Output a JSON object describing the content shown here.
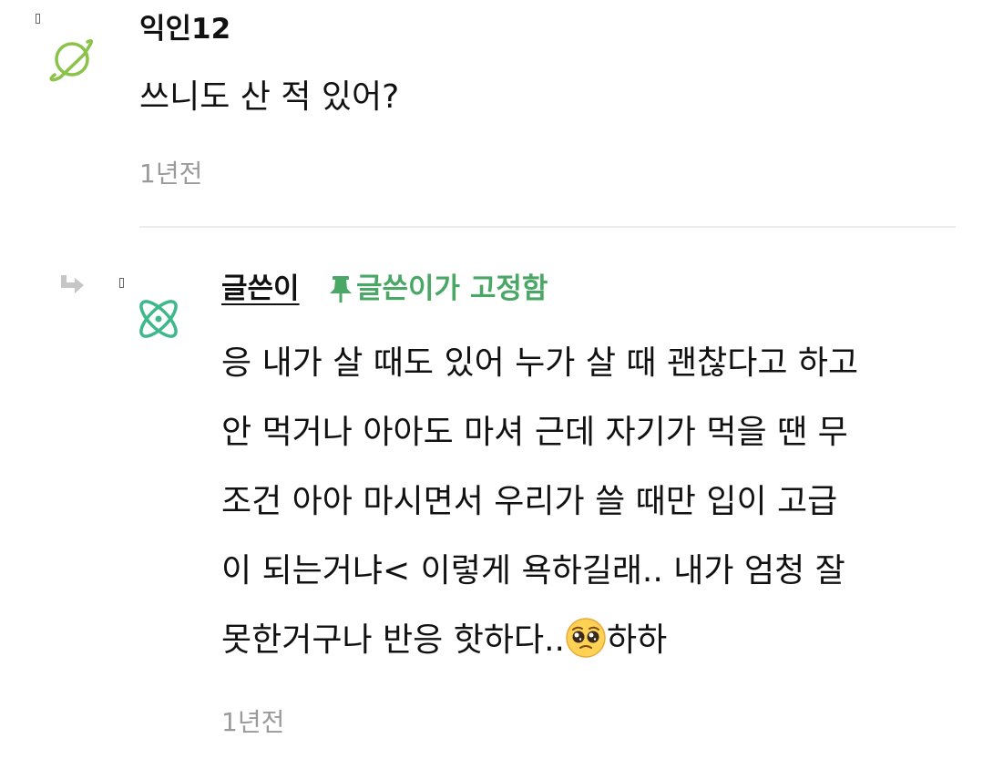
{
  "comment": {
    "username": "익인12",
    "text": "쓰니도 산 적 있어?",
    "timestamp": "1년전",
    "avatar_icon": "planet-icon",
    "avatar_color": "#8bc34a"
  },
  "reply": {
    "author": "글쓴이",
    "pinned_label": "글쓴이가 고정함",
    "pin_icon": "pushpin-icon",
    "pin_color": "#4aa766",
    "avatar_icon": "atom-icon",
    "avatar_color": "#3db88a",
    "lines": [
      "응 내가 살 때도 있어 누가 살 때 괜찮다고 하고",
      "안 먹거나 아아도 마셔 근데 자기가 먹을 땐 무",
      "조건 아아 마시면서 우리가 쓸 때만 입이 고급",
      "이 되는거냐< 이렇게 욕하길래.. 내가 엄청 잘",
      "못한거구나 반응 핫하다.."
    ],
    "line5_suffix": "하하",
    "emoji_icon": "pleading-face-icon",
    "timestamp": "1년전"
  }
}
